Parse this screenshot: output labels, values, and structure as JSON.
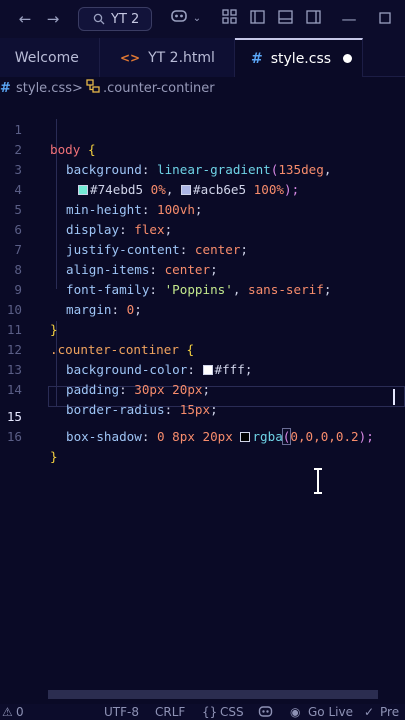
{
  "titlebar": {
    "search_text": "YT 2"
  },
  "tabs": [
    {
      "icon": "⬡",
      "label": "Welcome"
    },
    {
      "icon": "<>",
      "label": "YT 2.html"
    },
    {
      "icon": "#",
      "label": "style.css"
    }
  ],
  "breadcrumb": {
    "file": "style.css",
    "separator": ">",
    "symbol": ".counter-continer"
  },
  "editor": {
    "current_line": 15,
    "line_numbers": [
      "1",
      "2",
      "3",
      "4",
      "5",
      "6",
      "7",
      "8",
      "9",
      "10",
      "11",
      "12",
      "13",
      "14",
      "15",
      "16"
    ],
    "l1": {
      "sel": "body",
      "brace": "{"
    },
    "l2": {
      "prop": "background",
      "colon": ": ",
      "fn": "linear-gradient",
      "open": "(",
      "deg": "135deg",
      "comma": ","
    },
    "l3": {
      "c1": "#74ebd5",
      "p1": " 0%",
      "comma": ", ",
      "c2": "#acb6e5",
      "p2": " 100%",
      "close": ");"
    },
    "l4": {
      "prop": "min-height",
      "colon": ": ",
      "val": "100vh",
      "semi": ";"
    },
    "l5": {
      "prop": "display",
      "colon": ": ",
      "val": "flex",
      "semi": ";"
    },
    "l6": {
      "prop": "justify-content",
      "colon": ": ",
      "val": "center",
      "semi": ";"
    },
    "l7": {
      "prop": "align-items",
      "colon": ": ",
      "val": "center",
      "semi": ";"
    },
    "l8": {
      "prop": "font-family",
      "colon": ": ",
      "str": "'Poppins'",
      "comma": ", ",
      "val": "sans-serif",
      "semi": ";"
    },
    "l9": {
      "prop": "margin",
      "colon": ": ",
      "val": "0",
      "semi": ";"
    },
    "l10": {
      "brace": "}"
    },
    "l11": {
      "sel": ".counter-continer",
      "brace": "{"
    },
    "l12": {
      "prop": "background-color",
      "colon": ": ",
      "val": "#fff",
      "semi": ";"
    },
    "l13": {
      "prop": "padding",
      "colon": ": ",
      "v1": "30px",
      "v2": " 20px",
      "semi": ";"
    },
    "l14": {
      "prop": "border-radius",
      "colon": ": ",
      "val": "15px",
      "semi": ";"
    },
    "l15": {
      "prop": "box-shadow",
      "colon": ": ",
      "v1": "0",
      "v2": " 8px",
      "v3": " 20px",
      "fn": "rgba",
      "open": "(",
      "args": "0,0,0,0.2",
      "close": ");"
    },
    "l16": {
      "brace": "}"
    }
  },
  "statusbar": {
    "errors": "0",
    "encoding": "UTF-8",
    "eol": "CRLF",
    "braces": "{}",
    "language": "CSS",
    "golive": "Go Live",
    "prettier": "Pre"
  },
  "colors": {
    "background": "#0a0a26",
    "swatch_1": "#74ebd5",
    "swatch_2": "#acb6e5",
    "swatch_3": "#ffffff",
    "swatch_4": "#000000"
  }
}
